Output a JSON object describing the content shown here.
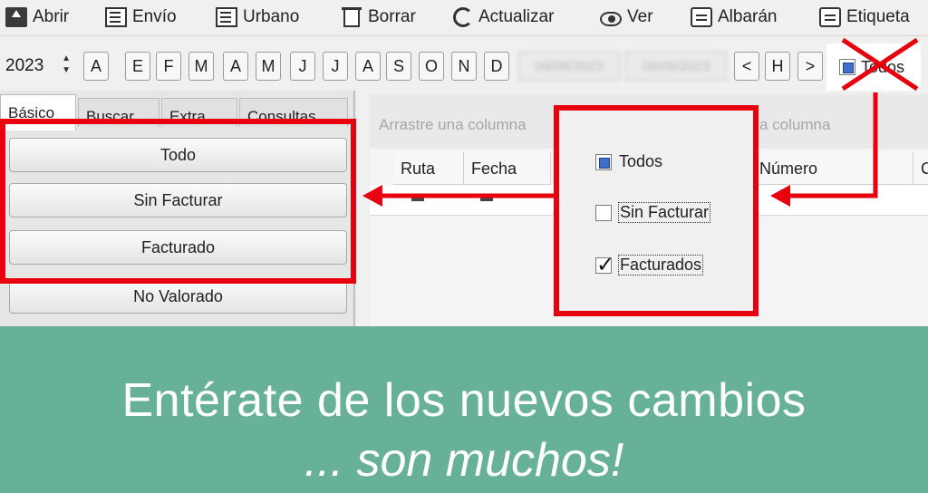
{
  "toolbar": {
    "items": [
      {
        "label": "Abrir",
        "icon": "upload-icon"
      },
      {
        "label": "Envío",
        "icon": "document-icon"
      },
      {
        "label": "Urbano",
        "icon": "document-icon"
      },
      {
        "label": "Borrar",
        "icon": "trash-icon"
      },
      {
        "label": "Actualizar",
        "icon": "refresh-icon"
      },
      {
        "label": "Ver",
        "icon": "eye-icon"
      },
      {
        "label": "Albarán",
        "icon": "printer-icon"
      },
      {
        "label": "Etiqueta",
        "icon": "printer-icon"
      }
    ]
  },
  "filterbar": {
    "year": "2023",
    "keys": [
      "A",
      "E",
      "F",
      "M",
      "A",
      "M",
      "J",
      "J",
      "A",
      "S",
      "O",
      "N",
      "D"
    ],
    "date_from": "09/06/2023",
    "date_to": "09/06/2023",
    "nav": [
      "<",
      "H",
      ">"
    ],
    "todos_label": "Todos"
  },
  "left_panel": {
    "tabs": [
      "Básico",
      "Buscar",
      "Extra",
      "Consultas"
    ],
    "buttons": [
      "Todo",
      "Sin Facturar",
      "Facturado",
      "No Valorado"
    ]
  },
  "grid": {
    "group_hint": "Arrastre una columna",
    "group_hint_end": "a columna",
    "columns": [
      "Ruta",
      "Fecha",
      "Número",
      "C"
    ]
  },
  "popup": {
    "options": [
      {
        "label": "Todos",
        "state": "indeterminate"
      },
      {
        "label": "Sin Facturar",
        "state": "unchecked"
      },
      {
        "label": "Facturados",
        "state": "checked"
      }
    ]
  },
  "banner": {
    "headline": "Entérate de los nuevos cambios",
    "subline": "... son muchos!",
    "background": "#67b297"
  },
  "colors": {
    "highlight_red": "#e8000f"
  }
}
